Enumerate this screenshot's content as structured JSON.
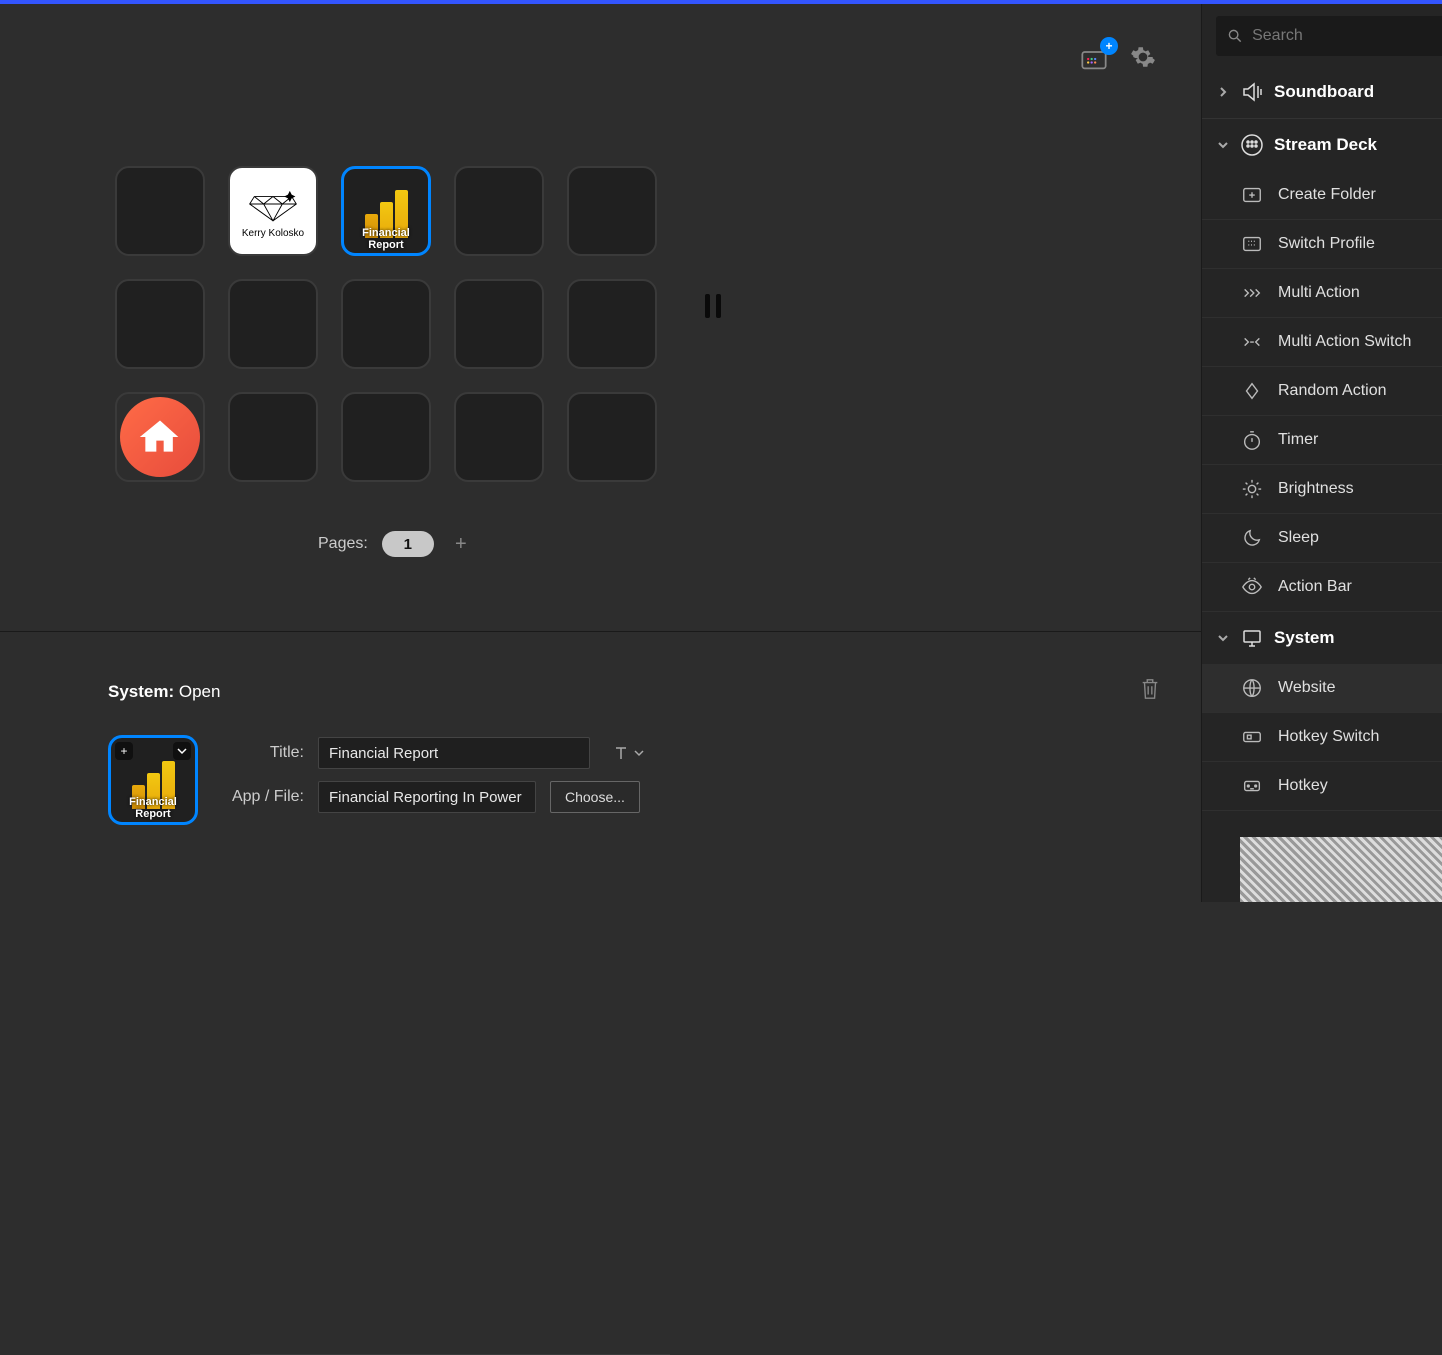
{
  "header": {
    "search_placeholder": "Search"
  },
  "keys": {
    "diamond_label": "Kerry Kolosko",
    "pbi_label": "Financial Report"
  },
  "pager": {
    "label": "Pages:",
    "current": "1"
  },
  "props": {
    "category": "System:",
    "action": "Open",
    "title_label": "Title:",
    "title_value": "Financial Report",
    "file_label": "App / File:",
    "file_value": "Financial Reporting In Power BI.pbix",
    "choose_label": "Choose...",
    "preview_label": "Financial Report"
  },
  "sidebar": {
    "soundboard": "Soundboard",
    "streamdeck": {
      "label": "Stream Deck",
      "items": [
        "Create Folder",
        "Switch Profile",
        "Multi Action",
        "Multi Action Switch",
        "Random Action",
        "Timer",
        "Brightness",
        "Sleep",
        "Action Bar"
      ]
    },
    "system": {
      "label": "System",
      "items": [
        "Website",
        "Hotkey Switch",
        "Hotkey"
      ]
    }
  }
}
